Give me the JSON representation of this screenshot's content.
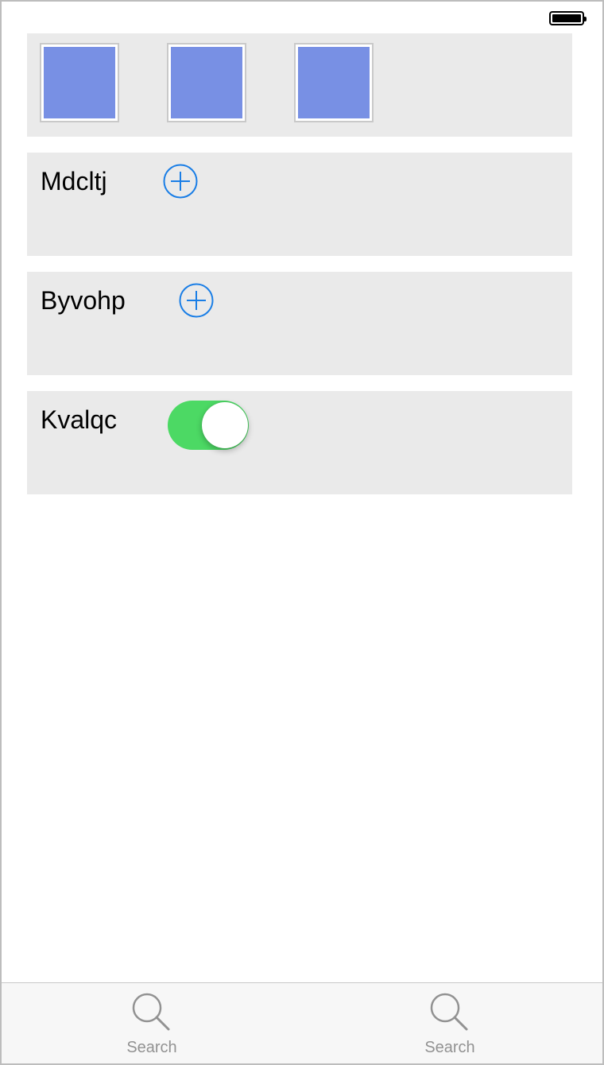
{
  "status_bar": {
    "battery_icon": "battery-full-icon"
  },
  "thumbnails": {
    "color": "#7890e4",
    "items": [
      {
        "name": "image-thumbnail-1"
      },
      {
        "name": "image-thumbnail-2"
      },
      {
        "name": "image-thumbnail-3"
      }
    ]
  },
  "rows": [
    {
      "label": "Mdcltj",
      "control": "add-circle-icon"
    },
    {
      "label": "Byvohp",
      "control": "add-circle-icon"
    },
    {
      "label": "Kvalqc",
      "control": "toggle",
      "toggle_on": true,
      "toggle_color": "#4cd964"
    }
  ],
  "tab_bar": {
    "items": [
      {
        "label": "Search",
        "icon": "search-icon"
      },
      {
        "label": "Search",
        "icon": "search-icon"
      }
    ]
  },
  "colors": {
    "accent_blue": "#1a7ee6",
    "card_background": "#eaeaea",
    "tab_label": "#929292"
  }
}
